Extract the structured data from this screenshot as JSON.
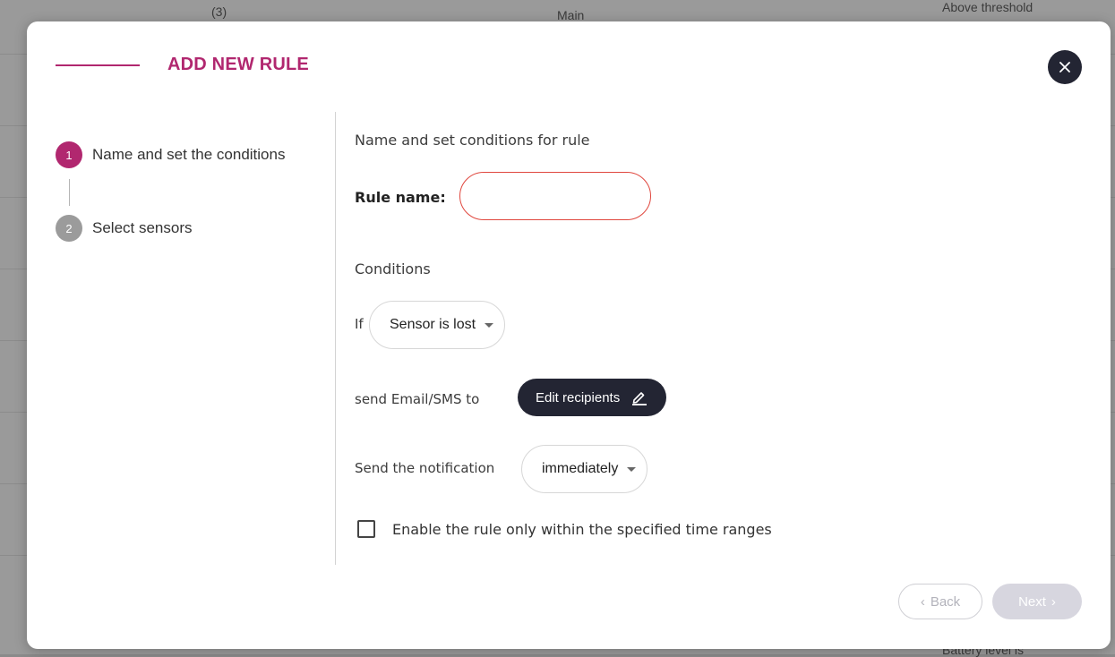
{
  "background": {
    "top_left_text": "(3)",
    "top_center_text": "Main",
    "top_right_text": "Above threshold",
    "bottom_right_text": "Battery level is"
  },
  "modal": {
    "title": "ADD NEW RULE",
    "close_icon": "close-icon"
  },
  "steps": [
    {
      "number": "1",
      "label": "Name and set the conditions",
      "active": true
    },
    {
      "number": "2",
      "label": "Select sensors",
      "active": false
    }
  ],
  "form": {
    "heading": "Name and set conditions for rule",
    "rule_name_label": "Rule name:",
    "rule_name_value": "",
    "conditions_heading": "Conditions",
    "if_label": "If",
    "condition_select": "Sensor is lost",
    "send_label": "send Email/SMS to",
    "edit_recipients": "Edit recipients",
    "edit_icon": "pencil-icon",
    "notification_label": "Send the notification",
    "notification_select": "immediately",
    "time_range_checkbox_label": "Enable the rule only within the specified time ranges",
    "time_range_checked": false
  },
  "footer": {
    "back": "Back",
    "next": "Next"
  },
  "colors": {
    "accent": "#b1276f",
    "dark": "#232533",
    "error": "#e0473e"
  }
}
